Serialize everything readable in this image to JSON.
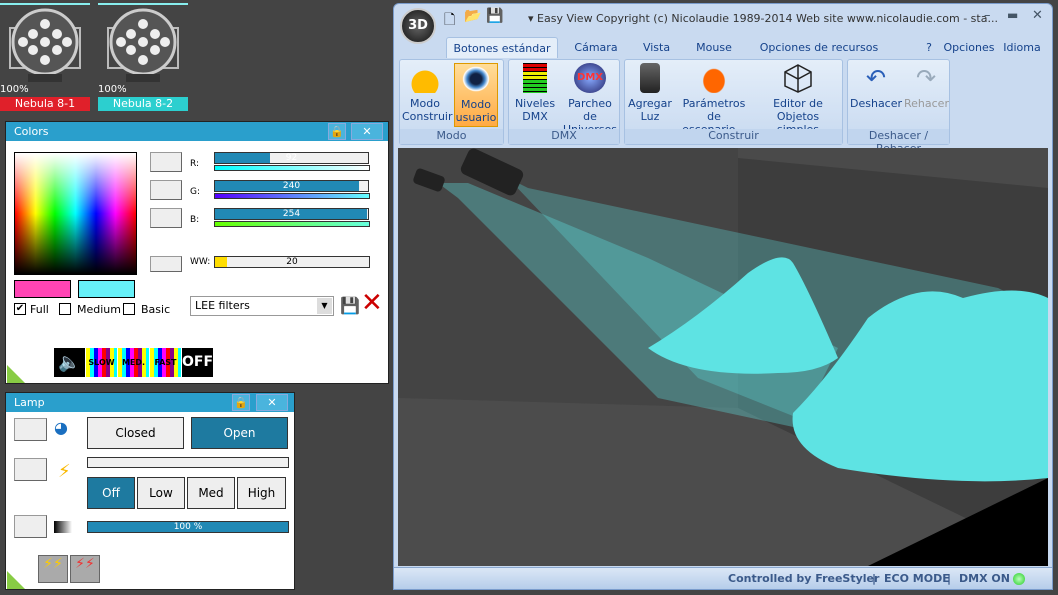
{
  "fixtures": [
    {
      "name": "Nebula 8-1",
      "level": "100%",
      "color": "#e0202a"
    },
    {
      "name": "Nebula 8-2",
      "level": "100%",
      "color": "#2ccfcf"
    }
  ],
  "colors_panel": {
    "title": "Colors",
    "labels": {
      "r": "R:",
      "g": "G:",
      "b": "B:",
      "ww": "WW:"
    },
    "values": {
      "r": 92,
      "g": 240,
      "b": 254,
      "ww": 20
    },
    "swatch_left": "#ff44b4",
    "swatch_right": "#66f0f8",
    "modes": [
      {
        "label": "Full",
        "checked": true
      },
      {
        "label": "Medium",
        "checked": false
      },
      {
        "label": "Basic",
        "checked": false
      }
    ],
    "filter_select": "LEE filters",
    "speed_buttons": [
      "SLOW",
      "MED.",
      "FAST",
      "OFF"
    ]
  },
  "lamp_panel": {
    "title": "Lamp",
    "shutter": {
      "closed": "Closed",
      "open": "Open",
      "active": "Open"
    },
    "power": {
      "options": [
        "Off",
        "Low",
        "Med",
        "High"
      ],
      "active": "Off"
    },
    "dimmer": "100 %",
    "dimmer_value": 100
  },
  "window": {
    "title": "Easy View   Copyright (c) Nicolaudie 1989-2014   Web site www.nicolaudie.com - sta...",
    "logo": "3D",
    "tabs": [
      "Botones estándar",
      "Cámara",
      "Vista",
      "Mouse",
      "Opciones de recursos"
    ],
    "active_tab": "Botones estándar",
    "right_menu": [
      "?",
      "Opciones",
      "Idioma"
    ],
    "groups": [
      {
        "label": "Modo",
        "buttons": [
          "Modo Construir",
          "Modo usuario"
        ]
      },
      {
        "label": "DMX",
        "buttons": [
          "Niveles DMX",
          "Parcheo de Universos"
        ]
      },
      {
        "label": "Construir",
        "buttons": [
          "Agregar Luz",
          "Parámetros de escenario...",
          "Editor de Objetos simples"
        ]
      },
      {
        "label": "Deshacer / Rehacer",
        "buttons": [
          "Deshacer",
          "Rehacer"
        ]
      }
    ],
    "icon_dmx": "DMX",
    "status": {
      "controlled": "Controlled by FreeStyler",
      "eco": "ECO MODE",
      "dmx": "DMX ON",
      "sep": "|"
    }
  }
}
